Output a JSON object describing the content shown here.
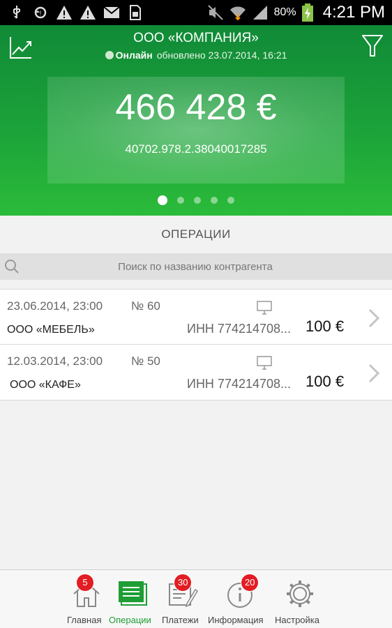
{
  "status_bar": {
    "time": "4:21 PM",
    "battery_percent": "80%",
    "left_icons": [
      "usb-icon",
      "sync-icon",
      "warning-icon",
      "warning-icon",
      "mail-icon",
      "sd-card-icon"
    ],
    "right_icons": [
      "mute-icon",
      "wifi-icon",
      "signal-icon",
      "battery-charging-icon"
    ]
  },
  "header": {
    "company": "ООО «КОМПАНИЯ»",
    "status": "Онлайн",
    "updated": "обновлено 23.07.2014, 16:21",
    "balance": "466 428 €",
    "account": "40702.978.2.38040017285",
    "page_count": 5,
    "active_page": 0,
    "accent": "#1da53a"
  },
  "operations_section": {
    "title": "ОПЕРАЦИИ",
    "search_placeholder": "Поиск по названию контрагента"
  },
  "operations": [
    {
      "date": "23.06.2014, 23:00",
      "number": "№ 60",
      "name": "ООО «МЕБЕЛЬ»",
      "inn": "ИНН 774214708...",
      "amount": "100 €"
    },
    {
      "date": "12.03.2014, 23:00",
      "number": "№ 50",
      "name": "ООО «КАФЕ»",
      "inn": "ИНН 774214708...",
      "amount": "100 €"
    }
  ],
  "bottom_nav": {
    "items": [
      {
        "label": "Главная",
        "icon": "home-icon",
        "badge": "5",
        "active": false
      },
      {
        "label": "Операции",
        "icon": "operations-icon",
        "badge": null,
        "active": true
      },
      {
        "label": "Платежи",
        "icon": "payments-icon",
        "badge": "30",
        "active": false
      },
      {
        "label": "Информация",
        "icon": "info-icon",
        "badge": "20",
        "active": false
      },
      {
        "label": "Настройка",
        "icon": "gear-icon",
        "badge": null,
        "active": false
      }
    ],
    "active_color": "#1e9e35",
    "badge_color": "#e21d23"
  }
}
